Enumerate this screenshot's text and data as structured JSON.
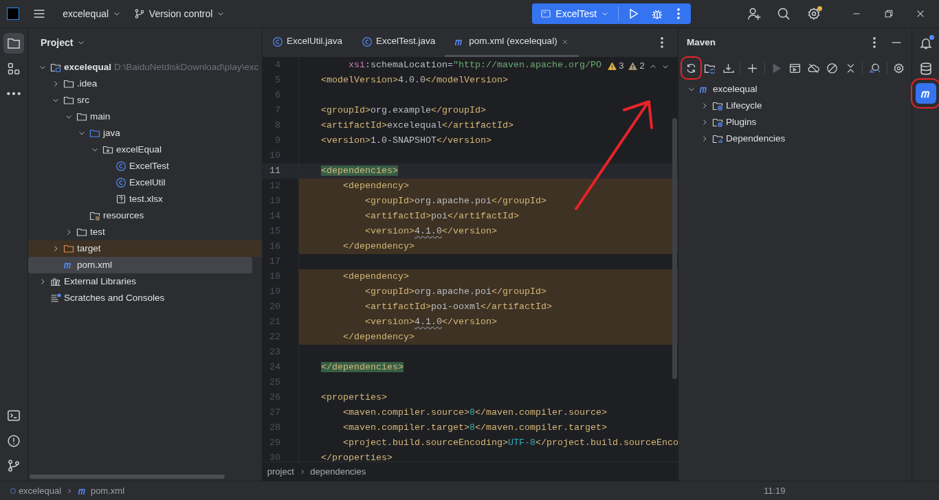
{
  "title_bar": {
    "project": "excelequal",
    "vcs": "Version control",
    "run_config": "ExcelTest",
    "settings_badge": true
  },
  "left_strip": {
    "top": [
      {
        "kind": "folder",
        "selected": true
      },
      {
        "kind": "structure",
        "selected": false
      },
      {
        "kind": "more",
        "selected": false
      }
    ],
    "bottom": [
      {
        "kind": "terminal",
        "selected": false
      },
      {
        "kind": "problems",
        "selected": false
      },
      {
        "kind": "git",
        "selected": false
      }
    ]
  },
  "project_panel": {
    "title": "Project",
    "tree": [
      {
        "label": "excelequal",
        "path": "D:\\BaiduNetdiskDownload\\play\\exc",
        "kind": "module",
        "expanded": true,
        "selected": false,
        "excluded": false,
        "children": [
          {
            "label": ".idea",
            "kind": "folder",
            "expanded": false,
            "selected": false,
            "excluded": false
          },
          {
            "label": "src",
            "kind": "folder",
            "expanded": true,
            "selected": false,
            "excluded": false,
            "children": [
              {
                "label": "main",
                "kind": "folder",
                "expanded": true,
                "selected": false,
                "excluded": false,
                "children": [
                  {
                    "label": "java",
                    "kind": "source-folder",
                    "expanded": true,
                    "selected": false,
                    "excluded": false,
                    "children": [
                      {
                        "label": "excelEqual",
                        "kind": "package",
                        "expanded": true,
                        "selected": false,
                        "excluded": false,
                        "children": [
                          {
                            "label": "ExcelTest",
                            "kind": "class",
                            "selected": false,
                            "excluded": false
                          },
                          {
                            "label": "ExcelUtil",
                            "kind": "class",
                            "selected": false,
                            "excluded": false
                          },
                          {
                            "label": "test.xlsx",
                            "kind": "unknown",
                            "selected": false,
                            "excluded": false
                          }
                        ]
                      }
                    ]
                  },
                  {
                    "label": "resources",
                    "kind": "resources",
                    "selected": false,
                    "excluded": false
                  }
                ]
              },
              {
                "label": "test",
                "kind": "folder",
                "expanded": false,
                "selected": false,
                "excluded": false
              }
            ]
          },
          {
            "label": "target",
            "kind": "excluded-folder",
            "expanded": false,
            "selected": false,
            "excluded": true
          },
          {
            "label": "pom.xml",
            "kind": "maven",
            "selected": true,
            "excluded": false
          }
        ]
      },
      {
        "label": "External Libraries",
        "kind": "library",
        "expanded": false,
        "selected": false,
        "excluded": false
      },
      {
        "label": "Scratches and Consoles",
        "kind": "scratches",
        "selected": false,
        "excluded": false
      }
    ]
  },
  "editor": {
    "tabs": [
      {
        "label": "ExcelUtil.java",
        "kind": "class",
        "selected": false
      },
      {
        "label": "ExcelTest.java",
        "kind": "class",
        "selected": false
      },
      {
        "label": "pom.xml (excelequal)",
        "kind": "maven",
        "selected": true
      }
    ],
    "inspections": [
      {
        "count": "3",
        "kind": "warning"
      },
      {
        "count": "2",
        "kind": "weak-warning"
      }
    ],
    "lines": [
      {
        "number": "4",
        "current": false,
        "changed": false,
        "segments": [
          {
            "text": "         xsi",
            "kind": "attr-ns"
          },
          {
            "text": ":schemaLocation=",
            "kind": "attr"
          },
          {
            "text": "\"http://maven.apache.org/PO",
            "kind": "string"
          }
        ]
      },
      {
        "number": "5",
        "current": false,
        "changed": false,
        "segments": [
          {
            "text": "    <modelVersion>",
            "kind": "tag"
          },
          {
            "text": "4.0.0",
            "kind": "value"
          },
          {
            "text": "</modelVersion>",
            "kind": "tag"
          }
        ]
      },
      {
        "number": "6",
        "current": false,
        "changed": false
      },
      {
        "number": "7",
        "current": false,
        "changed": false,
        "segments": [
          {
            "text": "    <groupId>",
            "kind": "tag"
          },
          {
            "text": "org.example",
            "kind": "value"
          },
          {
            "text": "</groupId>",
            "kind": "tag"
          }
        ]
      },
      {
        "number": "8",
        "current": false,
        "changed": false,
        "segments": [
          {
            "text": "    <artifactId>",
            "kind": "tag"
          },
          {
            "text": "excelequal",
            "kind": "value"
          },
          {
            "text": "</artifactId>",
            "kind": "tag"
          }
        ]
      },
      {
        "number": "9",
        "current": false,
        "changed": false,
        "segments": [
          {
            "text": "    <version>",
            "kind": "tag"
          },
          {
            "text": "1.0-SNAPSHOT",
            "kind": "value"
          },
          {
            "text": "</version>",
            "kind": "tag"
          }
        ]
      },
      {
        "number": "10",
        "current": false,
        "changed": false
      },
      {
        "number": "11",
        "current": true,
        "changed": false,
        "segments": [
          {
            "text": "    <dependencies>",
            "kind": "matched-tag"
          }
        ]
      },
      {
        "number": "12",
        "current": false,
        "changed": true,
        "segments": [
          {
            "text": "        <dependency>",
            "kind": "tag"
          }
        ]
      },
      {
        "number": "13",
        "current": false,
        "changed": true,
        "segments": [
          {
            "text": "            <groupId>",
            "kind": "tag"
          },
          {
            "text": "org.apache.poi",
            "kind": "value"
          },
          {
            "text": "</groupId>",
            "kind": "tag"
          }
        ]
      },
      {
        "number": "14",
        "current": false,
        "changed": true,
        "segments": [
          {
            "text": "            <artifactId>",
            "kind": "tag"
          },
          {
            "text": "poi",
            "kind": "value"
          },
          {
            "text": "</artifactId>",
            "kind": "tag"
          }
        ]
      },
      {
        "number": "15",
        "current": false,
        "changed": true,
        "segments": [
          {
            "text": "            <version>",
            "kind": "tag"
          },
          {
            "text": "4.1.0",
            "kind": "warn-value"
          },
          {
            "text": "</version>",
            "kind": "tag"
          }
        ]
      },
      {
        "number": "16",
        "current": false,
        "changed": true,
        "segments": [
          {
            "text": "        </dependency>",
            "kind": "tag"
          }
        ]
      },
      {
        "number": "17",
        "current": false,
        "changed": false
      },
      {
        "number": "18",
        "current": false,
        "changed": true,
        "segments": [
          {
            "text": "        <dependency>",
            "kind": "tag"
          }
        ]
      },
      {
        "number": "19",
        "current": false,
        "changed": true,
        "segments": [
          {
            "text": "            <groupId>",
            "kind": "tag"
          },
          {
            "text": "org.apache.poi",
            "kind": "value"
          },
          {
            "text": "</groupId>",
            "kind": "tag"
          }
        ]
      },
      {
        "number": "20",
        "current": false,
        "changed": true,
        "segments": [
          {
            "text": "            <artifactId>",
            "kind": "tag"
          },
          {
            "text": "poi-ooxml",
            "kind": "value"
          },
          {
            "text": "</artifactId>",
            "kind": "tag"
          }
        ]
      },
      {
        "number": "21",
        "current": false,
        "changed": true,
        "segments": [
          {
            "text": "            <version>",
            "kind": "tag"
          },
          {
            "text": "4.1.0",
            "kind": "warn-value"
          },
          {
            "text": "</version>",
            "kind": "tag"
          }
        ]
      },
      {
        "number": "22",
        "current": false,
        "changed": true,
        "segments": [
          {
            "text": "        </dependency>",
            "kind": "tag"
          }
        ]
      },
      {
        "number": "23",
        "current": false,
        "changed": false
      },
      {
        "number": "24",
        "current": false,
        "changed": false,
        "segments": [
          {
            "text": "    </dependencies>",
            "kind": "matched-tag"
          }
        ]
      },
      {
        "number": "25",
        "current": false,
        "changed": false
      },
      {
        "number": "26",
        "current": false,
        "changed": false,
        "segments": [
          {
            "text": "    <properties>",
            "kind": "tag"
          }
        ]
      },
      {
        "number": "27",
        "current": false,
        "changed": false,
        "segments": [
          {
            "text": "        <maven.compiler.source>",
            "kind": "tag"
          },
          {
            "text": "8",
            "kind": "number"
          },
          {
            "text": "</maven.compiler.source>",
            "kind": "tag"
          }
        ]
      },
      {
        "number": "28",
        "current": false,
        "changed": false,
        "segments": [
          {
            "text": "        <maven.compiler.target>",
            "kind": "tag"
          },
          {
            "text": "8",
            "kind": "number"
          },
          {
            "text": "</maven.compiler.target>",
            "kind": "tag"
          }
        ]
      },
      {
        "number": "29",
        "current": false,
        "changed": false,
        "segments": [
          {
            "text": "        <project.build.sourceEncoding>",
            "kind": "tag"
          },
          {
            "text": "UTF-8",
            "kind": "number"
          },
          {
            "text": "</project.build.sourceEnco",
            "kind": "tag"
          }
        ]
      },
      {
        "number": "30",
        "current": false,
        "changed": false,
        "segments": [
          {
            "text": "    </properties>",
            "kind": "tag"
          }
        ]
      }
    ],
    "breadcrumbs": [
      "project",
      "dependencies"
    ]
  },
  "maven_panel": {
    "title": "Maven",
    "toolbar": [
      {
        "kind": "reload",
        "highlighted": true
      },
      {
        "kind": "reload-folder",
        "highlighted": false
      },
      {
        "kind": "download",
        "highlighted": false
      },
      {
        "kind": "sep"
      },
      {
        "kind": "add",
        "highlighted": false
      },
      {
        "kind": "sep"
      },
      {
        "kind": "run",
        "highlighted": false
      },
      {
        "kind": "console",
        "highlighted": false
      },
      {
        "kind": "offline",
        "highlighted": false
      },
      {
        "kind": "skip",
        "highlighted": false
      },
      {
        "kind": "collapse",
        "highlighted": false
      },
      {
        "kind": "sep"
      },
      {
        "kind": "analyze",
        "highlighted": false
      },
      {
        "kind": "sep"
      },
      {
        "kind": "settings",
        "highlighted": false
      }
    ],
    "tree": [
      {
        "label": "excelequal",
        "kind": "maven",
        "expanded": true,
        "children": [
          {
            "label": "Lifecycle",
            "kind": "gear-folder",
            "expanded": false
          },
          {
            "label": "Plugins",
            "kind": "gear-folder",
            "expanded": false
          },
          {
            "label": "Dependencies",
            "kind": "chart-folder",
            "expanded": false
          }
        ]
      }
    ]
  },
  "right_strip": [
    {
      "kind": "notifications",
      "badge": true,
      "selected": false,
      "highlighted": false
    },
    {
      "kind": "database",
      "badge": false,
      "selected": false,
      "highlighted": false
    },
    {
      "kind": "maven",
      "badge": false,
      "selected": true,
      "highlighted": true
    }
  ],
  "status_bar": {
    "path": [
      "excelequal",
      "pom.xml"
    ],
    "position": "11:19"
  },
  "annotations": {
    "arrow": true
  }
}
